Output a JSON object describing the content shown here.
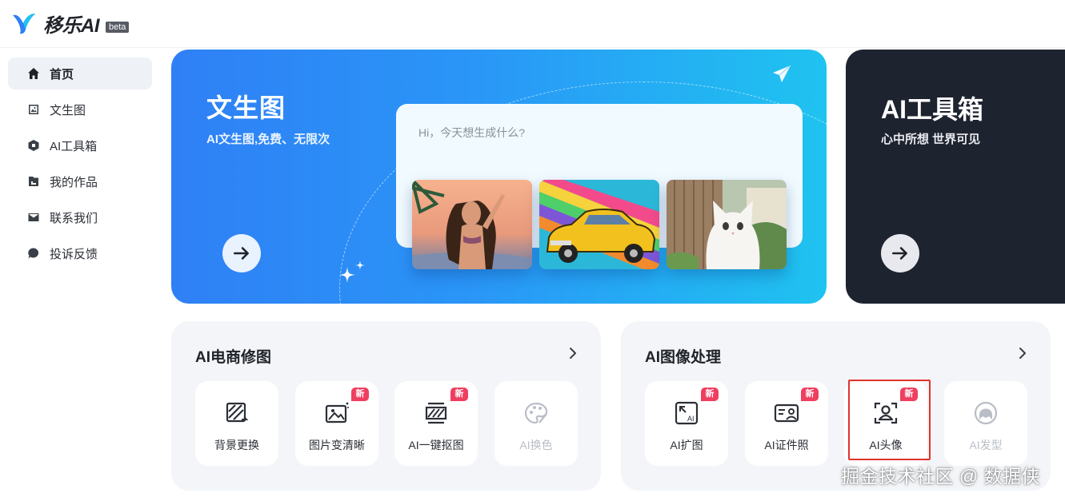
{
  "app": {
    "name": "移乐AI",
    "beta": "beta"
  },
  "sidebar": {
    "items": [
      {
        "label": "首页",
        "icon": "home-icon",
        "active": true
      },
      {
        "label": "文生图",
        "icon": "image-icon"
      },
      {
        "label": "AI工具箱",
        "icon": "toolbox-icon"
      },
      {
        "label": "我的作品",
        "icon": "folder-icon"
      },
      {
        "label": "联系我们",
        "icon": "mail-icon"
      },
      {
        "label": "投诉反馈",
        "icon": "feedback-icon"
      }
    ]
  },
  "hero": {
    "title": "文生图",
    "subtitle": "AI文生图,免费、无限次",
    "prompt_placeholder": "Hi，今天想生成什么?",
    "samples": [
      "woman-beach-illustration",
      "yellow-car-rainbow-illustration",
      "white-cat-garden-illustration"
    ]
  },
  "tools_card": {
    "title": "AI工具箱",
    "subtitle": "心中所想 世界可见"
  },
  "ecommerce": {
    "title": "AI电商修图",
    "tools": [
      {
        "label": "背景更换",
        "icon": "background-replace-icon",
        "badge": ""
      },
      {
        "label": "图片变清晰",
        "icon": "image-enhance-icon",
        "badge": "新"
      },
      {
        "label": "AI一键抠图",
        "icon": "cutout-icon",
        "badge": "新"
      },
      {
        "label": "AI换色",
        "icon": "palette-icon",
        "badge": "",
        "disabled": true
      }
    ]
  },
  "image_processing": {
    "title": "AI图像处理",
    "tools": [
      {
        "label": "AI扩图",
        "icon": "expand-image-icon",
        "badge": "新"
      },
      {
        "label": "AI证件照",
        "icon": "id-photo-icon",
        "badge": "新"
      },
      {
        "label": "AI头像",
        "icon": "avatar-icon",
        "badge": "新",
        "highlighted": true
      },
      {
        "label": "AI发型",
        "icon": "hairstyle-icon",
        "badge": "",
        "disabled": true
      }
    ]
  },
  "watermark": "掘金技术社区 @ 数据侠",
  "colors": {
    "accent": "#2f80f5",
    "badge": "#ef3e5f",
    "dark_card": "#1e2330",
    "highlight": "#e0332d"
  }
}
